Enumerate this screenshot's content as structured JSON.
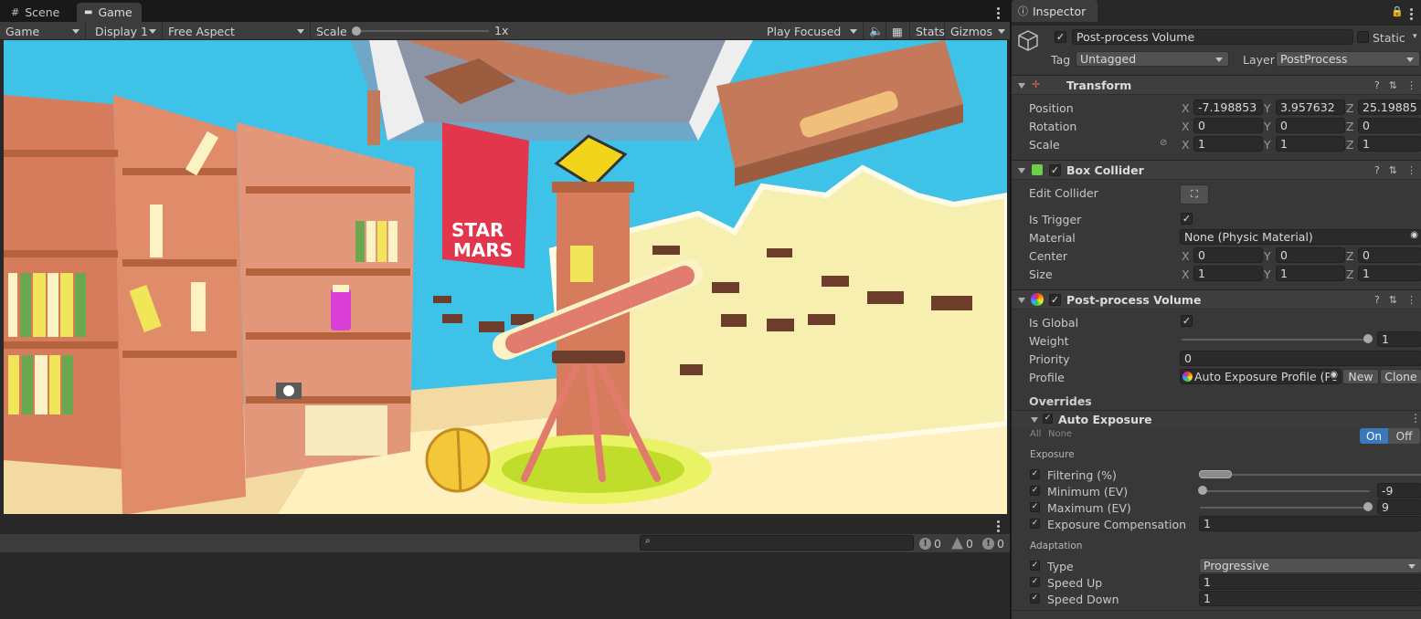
{
  "left_tabs": {
    "scene": "Scene",
    "game": "Game"
  },
  "game_toolbar": {
    "display_mode": "Game",
    "display": "Display 1",
    "aspect": "Free Aspect",
    "scale_label": "Scale",
    "scale_value": "1x",
    "play_focused": "Play Focused",
    "stats": "Stats",
    "gizmos": "Gizmos"
  },
  "scene_poster": {
    "line1": "STAR",
    "line2": "MARS"
  },
  "console": {
    "errors": "0",
    "warnings": "0",
    "messages": "0",
    "search_placeholder": ""
  },
  "inspector": {
    "tab": "Inspector",
    "object": {
      "name": "Post-process Volume",
      "static_label": "Static",
      "tag_label": "Tag",
      "tag": "Untagged",
      "layer_label": "Layer",
      "layer": "PostProcess"
    },
    "transform": {
      "title": "Transform",
      "position_label": "Position",
      "rotation_label": "Rotation",
      "scale_label": "Scale",
      "pos": {
        "x": "-7.198853",
        "y": "3.957632",
        "z": "25.19885"
      },
      "rot": {
        "x": "0",
        "y": "0",
        "z": "0"
      },
      "scl": {
        "x": "1",
        "y": "1",
        "z": "1"
      }
    },
    "box_collider": {
      "title": "Box Collider",
      "edit_label": "Edit Collider",
      "trigger_label": "Is Trigger",
      "material_label": "Material",
      "material": "None (Physic Material)",
      "center_label": "Center",
      "center": {
        "x": "0",
        "y": "0",
        "z": "0"
      },
      "size_label": "Size",
      "size": {
        "x": "1",
        "y": "1",
        "z": "1"
      }
    },
    "ppv": {
      "title": "Post-process Volume",
      "global_label": "Is Global",
      "weight_label": "Weight",
      "weight": "1",
      "priority_label": "Priority",
      "priority": "0",
      "profile_label": "Profile",
      "profile": "Auto Exposure Profile (Po",
      "new_btn": "New",
      "clone_btn": "Clone",
      "overrides_label": "Overrides",
      "effect_title": "Auto Exposure",
      "all": "All",
      "none": "None",
      "on": "On",
      "off": "Off",
      "exposure_section": "Exposure",
      "filtering_label": "Filtering (%)",
      "min_label": "Minimum (EV)",
      "min": "-9",
      "max_label": "Maximum (EV)",
      "max": "9",
      "comp_label": "Exposure Compensation",
      "comp": "1",
      "adaptation_section": "Adaptation",
      "type_label": "Type",
      "type": "Progressive",
      "up_label": "Speed Up",
      "up": "1",
      "down_label": "Speed Down",
      "down": "1"
    }
  },
  "colors": {
    "accent": "#3a79bb",
    "panel": "#383838",
    "header": "#3e3e3e"
  }
}
